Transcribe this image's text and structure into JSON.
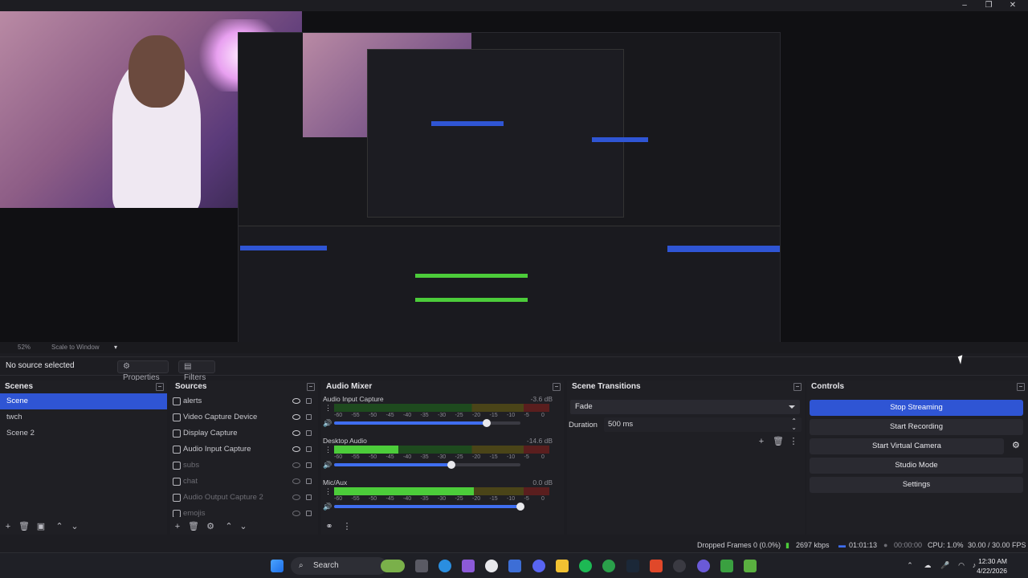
{
  "window": {
    "minimize": "–",
    "maximize": "❐",
    "close": "✕"
  },
  "preview": {
    "zoom": "52%",
    "scale_mode": "Scale to Window"
  },
  "toolbar": {
    "no_source": "No source selected",
    "properties": "Properties",
    "filters": "Filters"
  },
  "scenes": {
    "title": "Scenes",
    "items": [
      "Scene",
      "twch",
      "Scene 2"
    ],
    "selected": 0
  },
  "sources": {
    "title": "Sources",
    "items": [
      {
        "name": "alerts",
        "icon": "browser-icon",
        "visible": true
      },
      {
        "name": "Video Capture Device",
        "icon": "camera-icon",
        "visible": true
      },
      {
        "name": "Display Capture",
        "icon": "monitor-icon",
        "visible": true
      },
      {
        "name": "Audio Input Capture",
        "icon": "mic-icon",
        "visible": true
      },
      {
        "name": "subs",
        "icon": "browser-icon",
        "visible": false
      },
      {
        "name": "chat",
        "icon": "browser-icon",
        "visible": false
      },
      {
        "name": "Audio Output Capture 2",
        "icon": "speaker-icon",
        "visible": false
      },
      {
        "name": "emojis",
        "icon": "browser-icon",
        "visible": false
      }
    ]
  },
  "mixer": {
    "title": "Audio Mixer",
    "ticks": [
      "-60",
      "-55",
      "-50",
      "-45",
      "-40",
      "-35",
      "-30",
      "-25",
      "-20",
      "-15",
      "-10",
      "-5",
      "0"
    ],
    "tracks": [
      {
        "name": "Audio Input Capture",
        "db": "-3.6 dB",
        "level": 0.0,
        "volume": 0.82
      },
      {
        "name": "Desktop Audio",
        "db": "-14.6 dB",
        "level": 0.3,
        "volume": 0.63
      },
      {
        "name": "Mic/Aux",
        "db": "0.0 dB",
        "level": 0.65,
        "volume": 1.0
      }
    ]
  },
  "transitions": {
    "title": "Scene Transitions",
    "selected": "Fade",
    "duration_label": "Duration",
    "duration_value": "500 ms"
  },
  "controls": {
    "title": "Controls",
    "buttons": [
      "Stop Streaming",
      "Start Recording",
      "Start Virtual Camera",
      "Studio Mode",
      "Settings"
    ]
  },
  "status": {
    "dropped": "Dropped Frames 0 (0.0%)",
    "kbps": "2697 kbps",
    "stream_time": "01:01:13",
    "rec_time": "00:00:00",
    "cpu": "CPU: 1.0%",
    "fps": "30.00 / 30.00 FPS"
  },
  "taskbar": {
    "search": "Search",
    "time": "12:30 AM",
    "date": "4/22/2026"
  },
  "colors": {
    "accent": "#2f55d4",
    "meter_green": "#4ccc3a",
    "bg": "#1d1d22"
  }
}
